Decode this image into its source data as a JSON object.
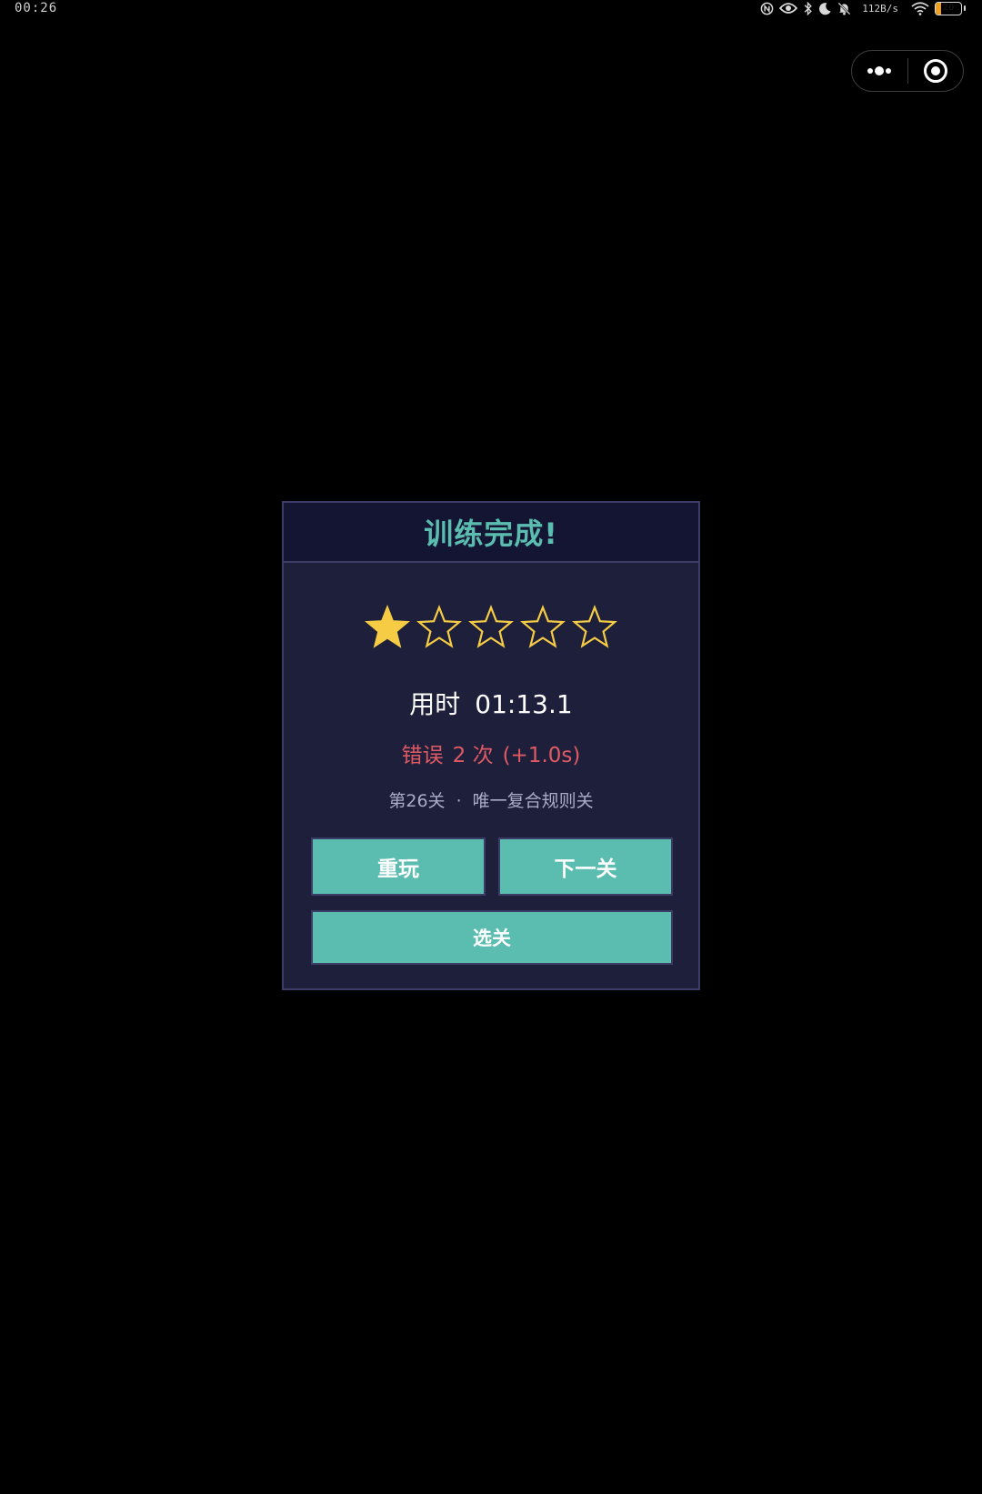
{
  "status_bar": {
    "time": "00:26",
    "net_speed": "112B/s",
    "battery_level": "20",
    "battery_fraction": 0.2,
    "battery_color": "#f0a020",
    "icons": [
      "nfc-icon",
      "eye-icon",
      "bluetooth-icon",
      "moon-icon",
      "bell-off-icon",
      "wifi-icon",
      "battery-icon"
    ]
  },
  "capsule": {
    "icons": [
      "more-dots-icon",
      "close-target-icon"
    ]
  },
  "result": {
    "title": "训练完成!",
    "stars_total": 5,
    "stars_earned": 1,
    "star_color": "#f7cc45",
    "time_label": "用时",
    "time_value": "01:13.1",
    "error_label": "错误",
    "error_count": "2 次",
    "error_penalty": "(+1.0s)",
    "level_number": "第26关",
    "level_separator": "·",
    "level_name": "唯一复合规则关"
  },
  "buttons": {
    "replay": "重玩",
    "next": "下一关",
    "select": "选关"
  },
  "colors": {
    "accent": "#5bbcb0",
    "panel": "#1e1f3b",
    "header": "#141532",
    "border": "#3b3d66",
    "error": "#e05a64"
  }
}
